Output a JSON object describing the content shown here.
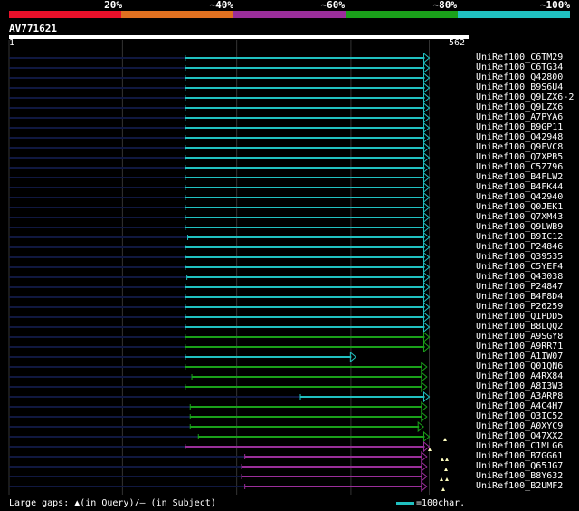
{
  "legend": {
    "segments": [
      {
        "color": "#e8102a",
        "label": "20%"
      },
      {
        "color": "#e07020",
        "label": "~40%"
      },
      {
        "color": "#9a2e9a",
        "label": "~60%"
      },
      {
        "color": "#1aa01a",
        "label": "~80%"
      },
      {
        "color": "#20c0c0",
        "label": "~100%"
      }
    ]
  },
  "query": {
    "id": "AV771621",
    "start": "1",
    "end": "562"
  },
  "colors": {
    "identity_100": "#20c0c0",
    "identity_80": "#1aa01a",
    "identity_60": "#9a2e9a",
    "unaligned": "#101840",
    "grid": "#333333",
    "gap_marker": "#ffffc0"
  },
  "hits": [
    {
      "id": "UniRef100_C6TM29",
      "start": 217,
      "end": 516,
      "tier": "100"
    },
    {
      "id": "UniRef100_C6TG34",
      "start": 217,
      "end": 516,
      "tier": "100"
    },
    {
      "id": "UniRef100_Q42800",
      "start": 217,
      "end": 516,
      "tier": "100"
    },
    {
      "id": "UniRef100_B9S6U4",
      "start": 217,
      "end": 516,
      "tier": "100"
    },
    {
      "id": "UniRef100_Q9LZX6-2",
      "start": 217,
      "end": 516,
      "tier": "100"
    },
    {
      "id": "UniRef100_Q9LZX6",
      "start": 217,
      "end": 516,
      "tier": "100"
    },
    {
      "id": "UniRef100_A7PYA6",
      "start": 217,
      "end": 516,
      "tier": "100"
    },
    {
      "id": "UniRef100_B9GP11",
      "start": 217,
      "end": 516,
      "tier": "100"
    },
    {
      "id": "UniRef100_Q42948",
      "start": 217,
      "end": 516,
      "tier": "100"
    },
    {
      "id": "UniRef100_Q9FVC8",
      "start": 217,
      "end": 516,
      "tier": "100"
    },
    {
      "id": "UniRef100_Q7XPB5",
      "start": 217,
      "end": 516,
      "tier": "100"
    },
    {
      "id": "UniRef100_C5Z796",
      "start": 217,
      "end": 516,
      "tier": "100"
    },
    {
      "id": "UniRef100_B4FLW2",
      "start": 217,
      "end": 516,
      "tier": "100"
    },
    {
      "id": "UniRef100_B4FK44",
      "start": 217,
      "end": 516,
      "tier": "100"
    },
    {
      "id": "UniRef100_Q42940",
      "start": 217,
      "end": 516,
      "tier": "100"
    },
    {
      "id": "UniRef100_Q0JEK1",
      "start": 217,
      "end": 516,
      "tier": "100"
    },
    {
      "id": "UniRef100_Q7XM43",
      "start": 217,
      "end": 516,
      "tier": "100"
    },
    {
      "id": "UniRef100_Q9LWB9",
      "start": 217,
      "end": 516,
      "tier": "100"
    },
    {
      "id": "UniRef100_B9IC12",
      "start": 220,
      "end": 516,
      "tier": "100"
    },
    {
      "id": "UniRef100_P24846",
      "start": 217,
      "end": 516,
      "tier": "100"
    },
    {
      "id": "UniRef100_Q39535",
      "start": 217,
      "end": 516,
      "tier": "100"
    },
    {
      "id": "UniRef100_C5YEF4",
      "start": 217,
      "end": 516,
      "tier": "100"
    },
    {
      "id": "UniRef100_Q43038",
      "start": 219,
      "end": 516,
      "tier": "100"
    },
    {
      "id": "UniRef100_P24847",
      "start": 217,
      "end": 516,
      "tier": "100"
    },
    {
      "id": "UniRef100_B4F8D4",
      "start": 217,
      "end": 516,
      "tier": "100"
    },
    {
      "id": "UniRef100_P26259",
      "start": 217,
      "end": 516,
      "tier": "100"
    },
    {
      "id": "UniRef100_Q1PDD5",
      "start": 217,
      "end": 516,
      "tier": "100"
    },
    {
      "id": "UniRef100_B8LQQ2",
      "start": 217,
      "end": 516,
      "tier": "100"
    },
    {
      "id": "UniRef100_A9SGY8",
      "start": 217,
      "end": 516,
      "tier": "80"
    },
    {
      "id": "UniRef100_A9RR71",
      "start": 217,
      "end": 516,
      "tier": "80"
    },
    {
      "id": "UniRef100_A1IW07",
      "start": 217,
      "end": 426,
      "tier": "100"
    },
    {
      "id": "UniRef100_Q01QN6",
      "start": 217,
      "end": 513,
      "tier": "80"
    },
    {
      "id": "UniRef100_A4RX84",
      "start": 225,
      "end": 513,
      "tier": "80"
    },
    {
      "id": "UniRef100_A8I3W3",
      "start": 217,
      "end": 513,
      "tier": "80"
    },
    {
      "id": "UniRef100_A3ARP8",
      "start": 358,
      "end": 516,
      "tier": "100"
    },
    {
      "id": "UniRef100_A4C4H7",
      "start": 223,
      "end": 513,
      "tier": "80"
    },
    {
      "id": "UniRef100_Q3IC52",
      "start": 223,
      "end": 513,
      "tier": "80"
    },
    {
      "id": "UniRef100_A0XYC9",
      "start": 223,
      "end": 509,
      "tier": "80"
    },
    {
      "id": "UniRef100_Q47XX2",
      "start": 233,
      "end": 516,
      "tier": "80"
    },
    {
      "id": "UniRef100_C1MLG6",
      "start": 217,
      "end": 516,
      "tier": "60"
    },
    {
      "id": "UniRef100_B7GG61",
      "start": 290,
      "end": 513,
      "tier": "60"
    },
    {
      "id": "UniRef100_Q65JG7",
      "start": 286,
      "end": 513,
      "tier": "60"
    },
    {
      "id": "UniRef100_B8Y632",
      "start": 286,
      "end": 513,
      "tier": "60"
    },
    {
      "id": "UniRef100_B2UMF2",
      "start": 290,
      "end": 513,
      "tier": "60"
    }
  ],
  "footer": {
    "gaps_text": "Large gaps: ▲(in Query)/— (in Subject)",
    "scale_label": "=100char."
  }
}
